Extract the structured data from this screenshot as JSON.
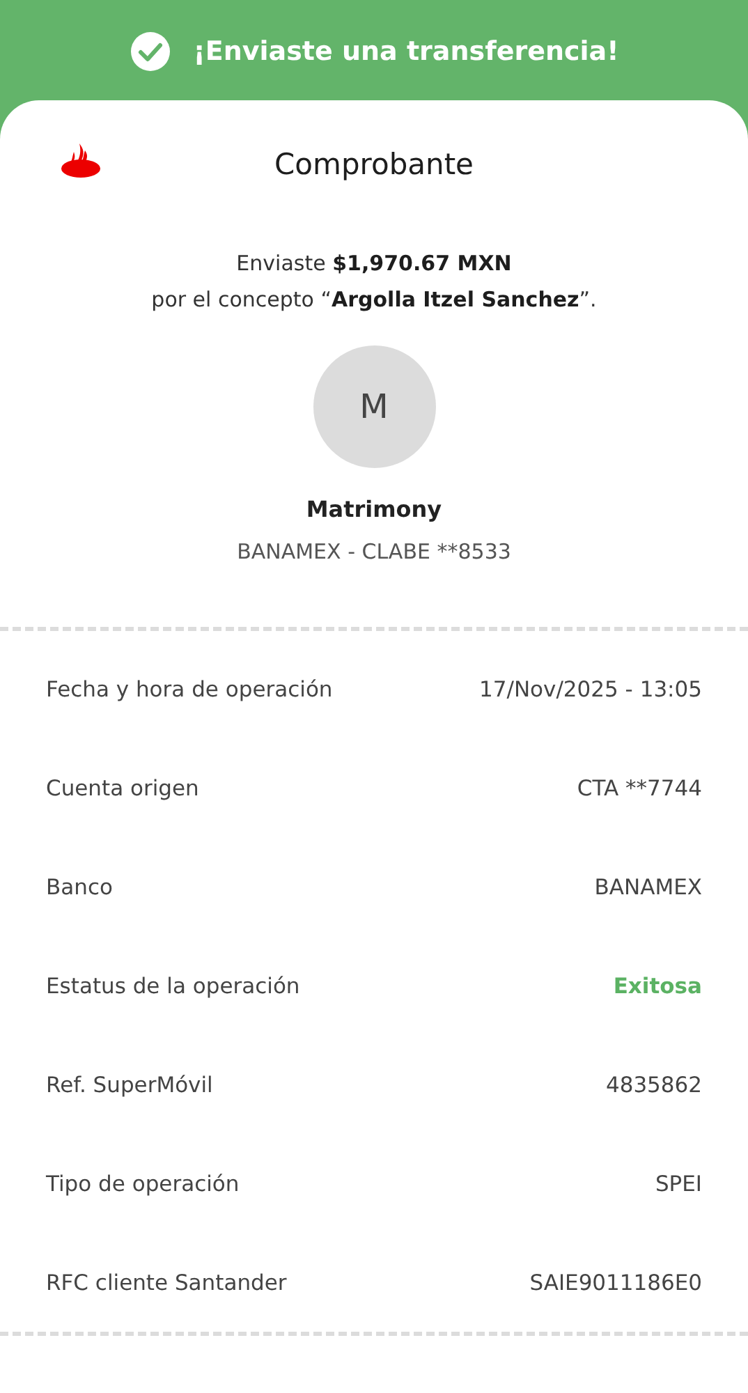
{
  "banner": {
    "title": "¡Enviaste una transferencia!"
  },
  "receipt": {
    "title": "Comprobante",
    "summary": "Enviaste **$1,970.67 MXN**\npor el concepto “**Argolla Itzel Sanchez**”."
  },
  "recipient": {
    "initial": "M",
    "name": "Matrimony",
    "account": "BANAMEX - CLABE **8533"
  },
  "details": [
    {
      "label": "Fecha y hora de operación",
      "value": "17/Nov/2025 - 13:05",
      "kind": "plain"
    },
    {
      "label": "Cuenta origen",
      "value": "CTA **7744",
      "kind": "plain"
    },
    {
      "label": "Banco",
      "value": "BANAMEX",
      "kind": "plain"
    },
    {
      "label": "Estatus de la operación",
      "value": "Exitosa",
      "kind": "status"
    },
    {
      "label": "Ref. SuperMóvil",
      "value": "4835862",
      "kind": "plain"
    },
    {
      "label": "Tipo de operación",
      "value": "SPEI",
      "kind": "plain"
    },
    {
      "label": "RFC cliente Santander",
      "value": "SAIE9011186E0",
      "kind": "plain"
    }
  ]
}
